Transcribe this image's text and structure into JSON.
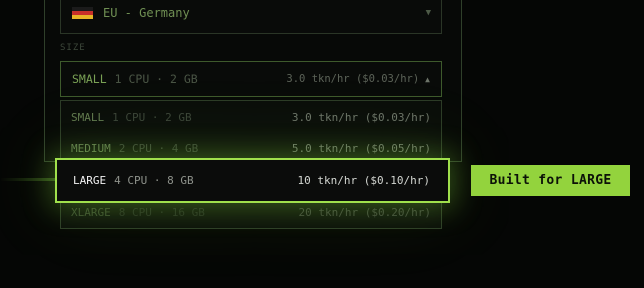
{
  "region": {
    "selected_label": "EU - Germany",
    "flag_icon": "germany-flag-icon"
  },
  "size": {
    "section_label": "SIZE",
    "selected": {
      "name": "SMALL",
      "spec": "1 CPU · 2 GB",
      "price": "3.0 tkn/hr ($0.03/hr)"
    },
    "options": [
      {
        "name": "SMALL",
        "spec": "1 CPU · 2 GB",
        "price": "3.0 tkn/hr ($0.03/hr)"
      },
      {
        "name": "MEDIUM",
        "spec": "2 CPU · 4 GB",
        "price": "5.0 tkn/hr ($0.05/hr)"
      },
      {
        "name": "LARGE",
        "spec": "4 CPU · 8 GB",
        "price": "10 tkn/hr ($0.10/hr)"
      },
      {
        "name": "XLARGE",
        "spec": "8 CPU · 16 GB",
        "price": "20 tkn/hr ($0.20/hr)"
      }
    ],
    "highlighted_index": 2
  },
  "callout": {
    "label": "Built for LARGE"
  },
  "colors": {
    "accent": "#93d33d",
    "highlight_border": "#a0e04c",
    "background": "#050605"
  }
}
